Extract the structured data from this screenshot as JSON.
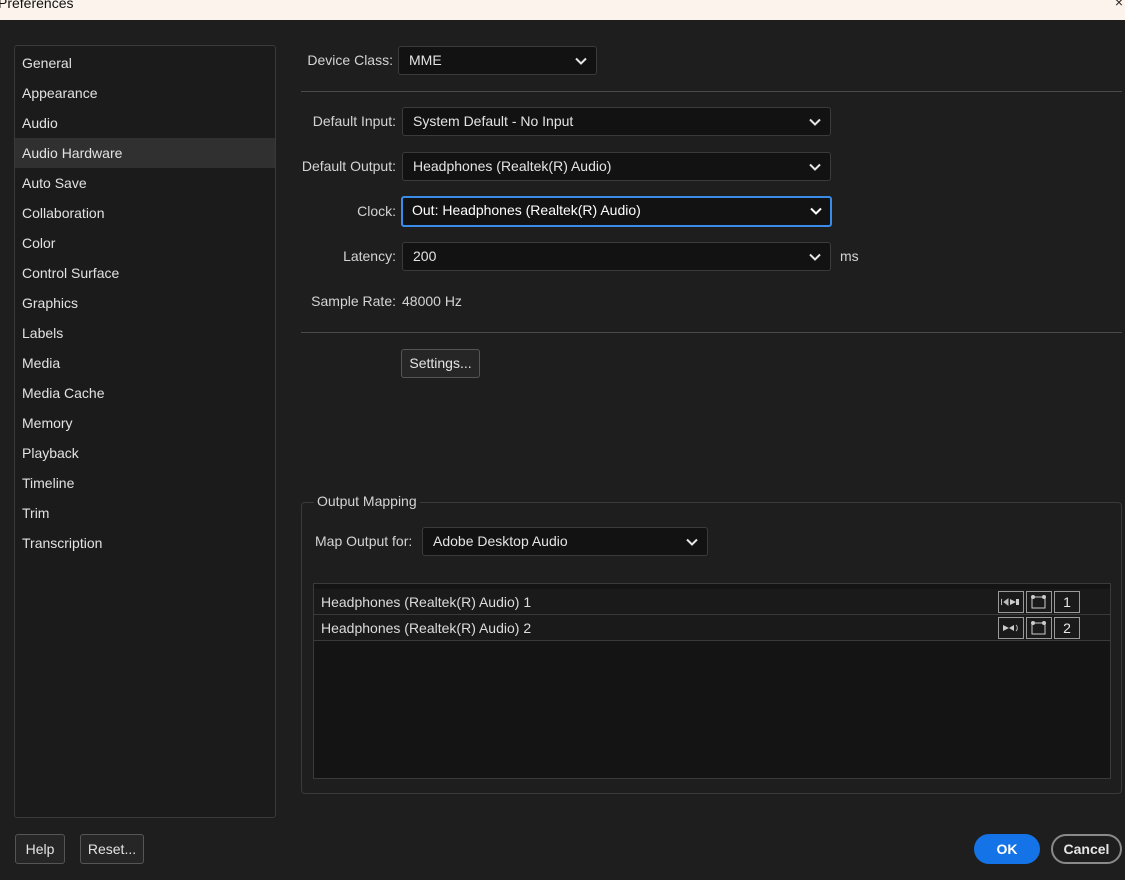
{
  "window": {
    "title": "Preferences",
    "close_glyph": "×"
  },
  "sidebar": {
    "items": [
      {
        "label": "General"
      },
      {
        "label": "Appearance"
      },
      {
        "label": "Audio"
      },
      {
        "label": "Audio Hardware",
        "selected": true
      },
      {
        "label": "Auto Save"
      },
      {
        "label": "Collaboration"
      },
      {
        "label": "Color"
      },
      {
        "label": "Control Surface"
      },
      {
        "label": "Graphics"
      },
      {
        "label": "Labels"
      },
      {
        "label": "Media"
      },
      {
        "label": "Media Cache"
      },
      {
        "label": "Memory"
      },
      {
        "label": "Playback"
      },
      {
        "label": "Timeline"
      },
      {
        "label": "Trim"
      },
      {
        "label": "Transcription"
      }
    ]
  },
  "audio_hardware": {
    "device_class_label": "Device Class:",
    "device_class_value": "MME",
    "default_input_label": "Default Input:",
    "default_input_value": "System Default - No Input",
    "default_output_label": "Default Output:",
    "default_output_value": "Headphones (Realtek(R) Audio)",
    "clock_label": "Clock:",
    "clock_value": "Out: Headphones (Realtek(R) Audio)",
    "latency_label": "Latency:",
    "latency_value": "200",
    "latency_unit": "ms",
    "sample_rate_label": "Sample Rate:",
    "sample_rate_value": "48000 Hz",
    "settings_button": "Settings..."
  },
  "output_mapping": {
    "group_title": "Output Mapping",
    "map_output_for_label": "Map Output for:",
    "map_output_for_value": "Adobe Desktop Audio",
    "channels": [
      {
        "label": "Headphones (Realtek(R) Audio) 1",
        "number": "1",
        "speaker_icon": "speaker-left-icon"
      },
      {
        "label": "Headphones (Realtek(R) Audio) 2",
        "number": "2",
        "speaker_icon": "speaker-right-icon"
      }
    ]
  },
  "footer": {
    "help_button": "Help",
    "reset_button": "Reset...",
    "ok_button": "OK",
    "cancel_button": "Cancel"
  },
  "colors": {
    "accent": "#1473e6",
    "focus_border": "#3b8be8",
    "background": "#1e1e1e"
  }
}
